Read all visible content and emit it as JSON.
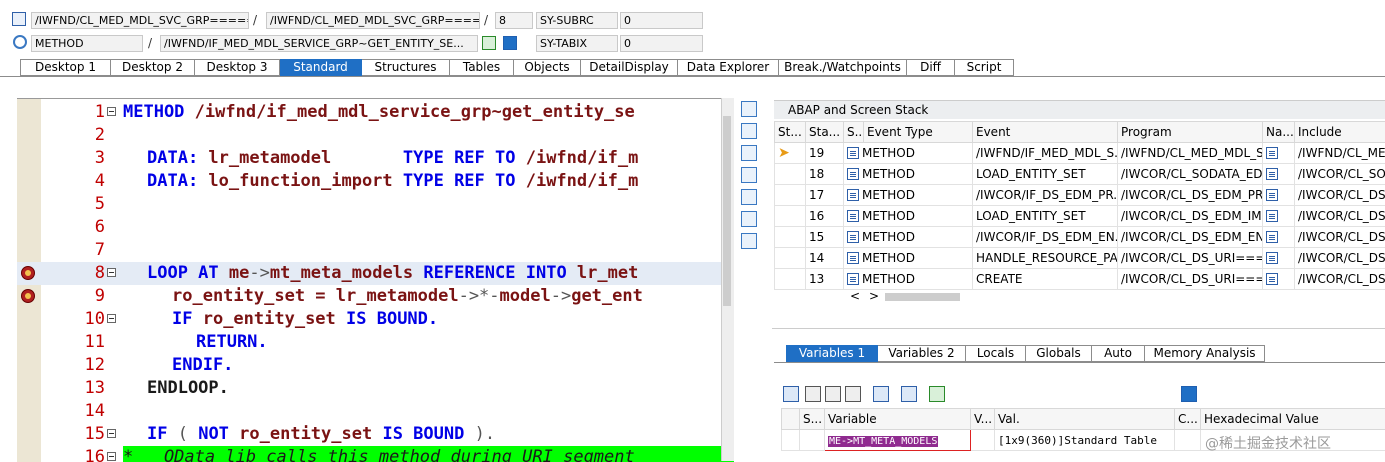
{
  "header": {
    "row1": {
      "field1": "/IWFND/CL_MED_MDL_SVC_GRP=====",
      "field2": "/IWFND/CL_MED_MDL_SVC_GRP=====",
      "field3": "8",
      "field4_label": "SY-SUBRC",
      "field4_value": "0"
    },
    "row2": {
      "field1": "METHOD",
      "field2": "/IWFND/IF_MED_MDL_SERVICE_GRP~GET_ENTITY_SE...",
      "field4_label": "SY-TABIX",
      "field4_value": "0"
    },
    "sep": "/"
  },
  "tabs": [
    {
      "label": "Desktop 1"
    },
    {
      "label": "Desktop 2"
    },
    {
      "label": "Desktop 3"
    },
    {
      "label": "Standard"
    },
    {
      "label": "Structures"
    },
    {
      "label": "Tables"
    },
    {
      "label": "Objects"
    },
    {
      "label": "DetailDisplay"
    },
    {
      "label": "Data Explorer"
    },
    {
      "label": "Break./Watchpoints"
    },
    {
      "label": "Diff"
    },
    {
      "label": "Script"
    }
  ],
  "active_tab": "Standard",
  "code": {
    "lines": [
      {
        "n": "1"
      },
      {
        "n": "2"
      },
      {
        "n": "3"
      },
      {
        "n": "4"
      },
      {
        "n": "5"
      },
      {
        "n": "6"
      },
      {
        "n": "7"
      },
      {
        "n": "8"
      },
      {
        "n": "9"
      },
      {
        "n": "10"
      },
      {
        "n": "11"
      },
      {
        "n": "12"
      },
      {
        "n": "13"
      },
      {
        "n": "14"
      },
      {
        "n": "15"
      },
      {
        "n": "16"
      }
    ],
    "t1_kw": "METHOD",
    "t1_tx": " /iwfnd/if_med_mdl_service_grp~get_entity_se",
    "t3_kw": "DATA:",
    "t3_tx": " lr_metamodel       ",
    "t3_kw2": "TYPE REF TO",
    "t3_tx2": " /iwfnd/if_m",
    "t4_kw": "DATA:",
    "t4_tx": " lo_function_import ",
    "t4_kw2": "TYPE REF TO",
    "t4_tx2": " /iwfnd/if_m",
    "t8_kw": "LOOP AT",
    "t8_tx": " me",
    "t8_op": "->",
    "t8_tx2": "mt_meta_models ",
    "t8_kw2": "REFERENCE INTO",
    "t8_tx3": " lr_met",
    "t9_tx": "ro_entity_set = lr_metamodel",
    "t9_op": "->*-",
    "t9_tx2": "model",
    "t9_op2": "->",
    "t9_tx3": "get_ent",
    "t10_kw": "IF",
    "t10_tx": " ro_entity_set ",
    "t10_kw2": "IS BOUND.",
    "t11_kw": "RETURN.",
    "t12_kw": "ENDIF.",
    "t13_tx": "ENDLOOP.",
    "t15_kw": "IF",
    "t15_op": " ( ",
    "t15_kw2": "NOT",
    "t15_tx": " ro_entity_set ",
    "t15_kw3": "IS BOUND",
    "t15_op2": " ).",
    "t16_cm": "*   OData lib calls this method during URI segment"
  },
  "stack": {
    "title": "ABAP and Screen Stack",
    "columns": [
      "St...",
      "Sta...",
      "S...",
      "Event Type",
      "Event",
      "Program",
      "Na...",
      "Include"
    ],
    "rows": [
      {
        "sta": "19",
        "type": "METHOD",
        "event": "/IWFND/IF_MED_MDL_S...",
        "program": "/IWFND/CL_MED_MDL_S...",
        "include": "/IWFND/CL_MEI"
      },
      {
        "sta": "18",
        "type": "METHOD",
        "event": "LOAD_ENTITY_SET",
        "program": "/IWCOR/CL_SODATA_ED...",
        "include": "/IWCOR/CL_SOD"
      },
      {
        "sta": "17",
        "type": "METHOD",
        "event": "/IWCOR/IF_DS_EDM_PR...",
        "program": "/IWCOR/CL_DS_EDM_PR...",
        "include": "/IWCOR/CL_DS_"
      },
      {
        "sta": "16",
        "type": "METHOD",
        "event": "LOAD_ENTITY_SET",
        "program": "/IWCOR/CL_DS_EDM_IM...",
        "include": "/IWCOR/CL_DS_"
      },
      {
        "sta": "15",
        "type": "METHOD",
        "event": "/IWCOR/IF_DS_EDM_EN...",
        "program": "/IWCOR/CL_DS_EDM_EN...",
        "include": "/IWCOR/CL_DS_"
      },
      {
        "sta": "14",
        "type": "METHOD",
        "event": "HANDLE_RESOURCE_PA...",
        "program": "/IWCOR/CL_DS_URI===...",
        "include": "/IWCOR/CL_DS_"
      },
      {
        "sta": "13",
        "type": "METHOD",
        "event": "CREATE",
        "program": "/IWCOR/CL_DS_URI===...",
        "include": "/IWCOR/CL_DS_"
      }
    ],
    "nav_left": "<",
    "nav_right": ">"
  },
  "var_tabs": [
    {
      "label": "Variables 1"
    },
    {
      "label": "Variables 2"
    },
    {
      "label": "Locals"
    },
    {
      "label": "Globals"
    },
    {
      "label": "Auto"
    },
    {
      "label": "Memory Analysis"
    }
  ],
  "var_table": {
    "columns": [
      "S...",
      "Variable",
      "V...",
      "Val.",
      "C...",
      "Hexadecimal Value"
    ],
    "row": {
      "variable": "ME->MT_META_MODELS",
      "value": "[1x9(360)]Standard Table"
    }
  },
  "watermark": "@稀土掘金技术社区",
  "colors": {
    "accent": "#1f6fc5",
    "line_number": "#c00000",
    "keyword": "#0000e6",
    "identifier": "#7a1313",
    "comment_bg": "#00ff00"
  }
}
